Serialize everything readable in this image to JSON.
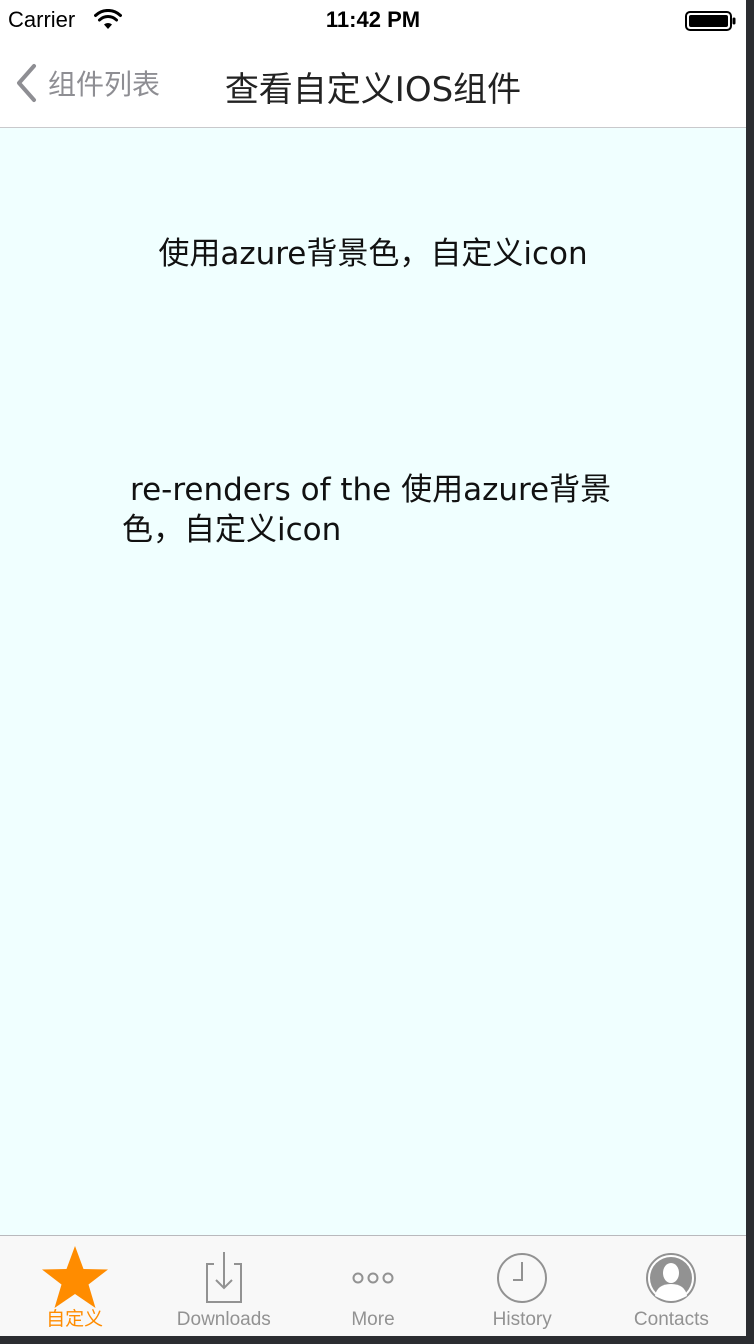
{
  "status_bar": {
    "carrier": "Carrier",
    "time": "11:42 PM"
  },
  "nav": {
    "back_label": "组件列表",
    "title": "查看自定义IOS组件"
  },
  "content": {
    "line1": "使用azure背景色，自定义icon",
    "line2": "re-renders of the 使用azure背景色，自定义icon",
    "background_color": "#f0ffff"
  },
  "tab_bar": {
    "tabs": [
      {
        "label": "自定义",
        "icon": "star-icon",
        "active": true
      },
      {
        "label": "Downloads",
        "icon": "download-icon",
        "active": false
      },
      {
        "label": "More",
        "icon": "more-icon",
        "active": false
      },
      {
        "label": "History",
        "icon": "history-icon",
        "active": false
      },
      {
        "label": "Contacts",
        "icon": "contacts-icon",
        "active": false
      }
    ],
    "active_color": "#ff8c00",
    "inactive_color": "#929292"
  }
}
